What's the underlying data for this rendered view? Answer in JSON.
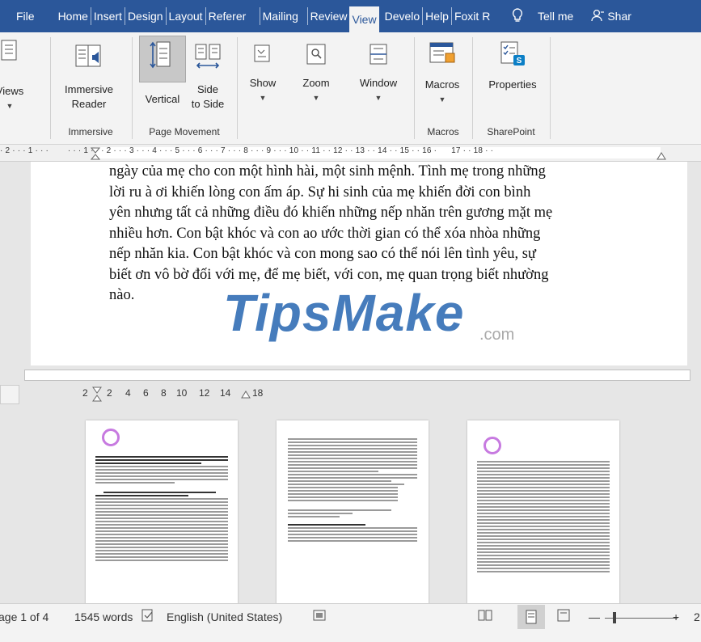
{
  "tabs": [
    "File",
    "Home",
    "Insert",
    "Design",
    "Layout",
    "Referer",
    "Mailing",
    "Review",
    "View",
    "Develo",
    "Help",
    "Foxit R"
  ],
  "active_tab": "View",
  "tell_me": "Tell me",
  "share": "Shar",
  "ribbon": {
    "views_label": "Views",
    "immersive_reader": [
      "Immersive",
      "Reader"
    ],
    "vertical": "Vertical",
    "side_to_side": [
      "Side",
      "to Side"
    ],
    "show": "Show",
    "zoom": "Zoom",
    "window": "Window",
    "macros": "Macros",
    "properties": "Properties",
    "groups": {
      "immersive": "Immersive",
      "page_movement": "Page Movement",
      "macros": "Macros",
      "sharepoint": "SharePoint"
    }
  },
  "ruler_text": "· 2 · · · 1 · · ·        · · · 1 · · · 2 · · · 3 · · · 4 · · · 5 · · · 6 · · · 7 · · · 8 · · · 9 · · · 10 · · 11 · · 12 · · 13 · · 14 · · 15 · · 16 ·      17 · · 18 · ·",
  "body_lines": [
    "ngày của mẹ cho con một hình hài, một sinh mệnh. Tình mẹ trong những",
    "lời ru à ơi khiến lòng con ấm áp. Sự hi sinh của mẹ khiến đời con bình",
    "yên nhưng tất cả những điều đó khiến những nếp nhăn trên gương mặt mẹ",
    "nhiều hơn. Con bật khóc và con ao ước thời gian có thể xóa nhòa những",
    "nếp nhăn kia. Con bật khóc và con mong sao có thể nói lên tình yêu, sự",
    "biết ơn vô bờ đối với mẹ, để mẹ biết, với con, mẹ quan trọng biết nhường",
    "nào."
  ],
  "watermark": "TipsMake",
  "watermark_suffix": ".com",
  "ruler2": [
    "2",
    "2",
    "4",
    "6",
    "8",
    "10",
    "12",
    "14",
    "18"
  ],
  "status": {
    "page": "age 1 of 4",
    "words": "1545 words",
    "language": "English (United States)",
    "zoom_plus": "+",
    "zoom_pct": "2"
  }
}
